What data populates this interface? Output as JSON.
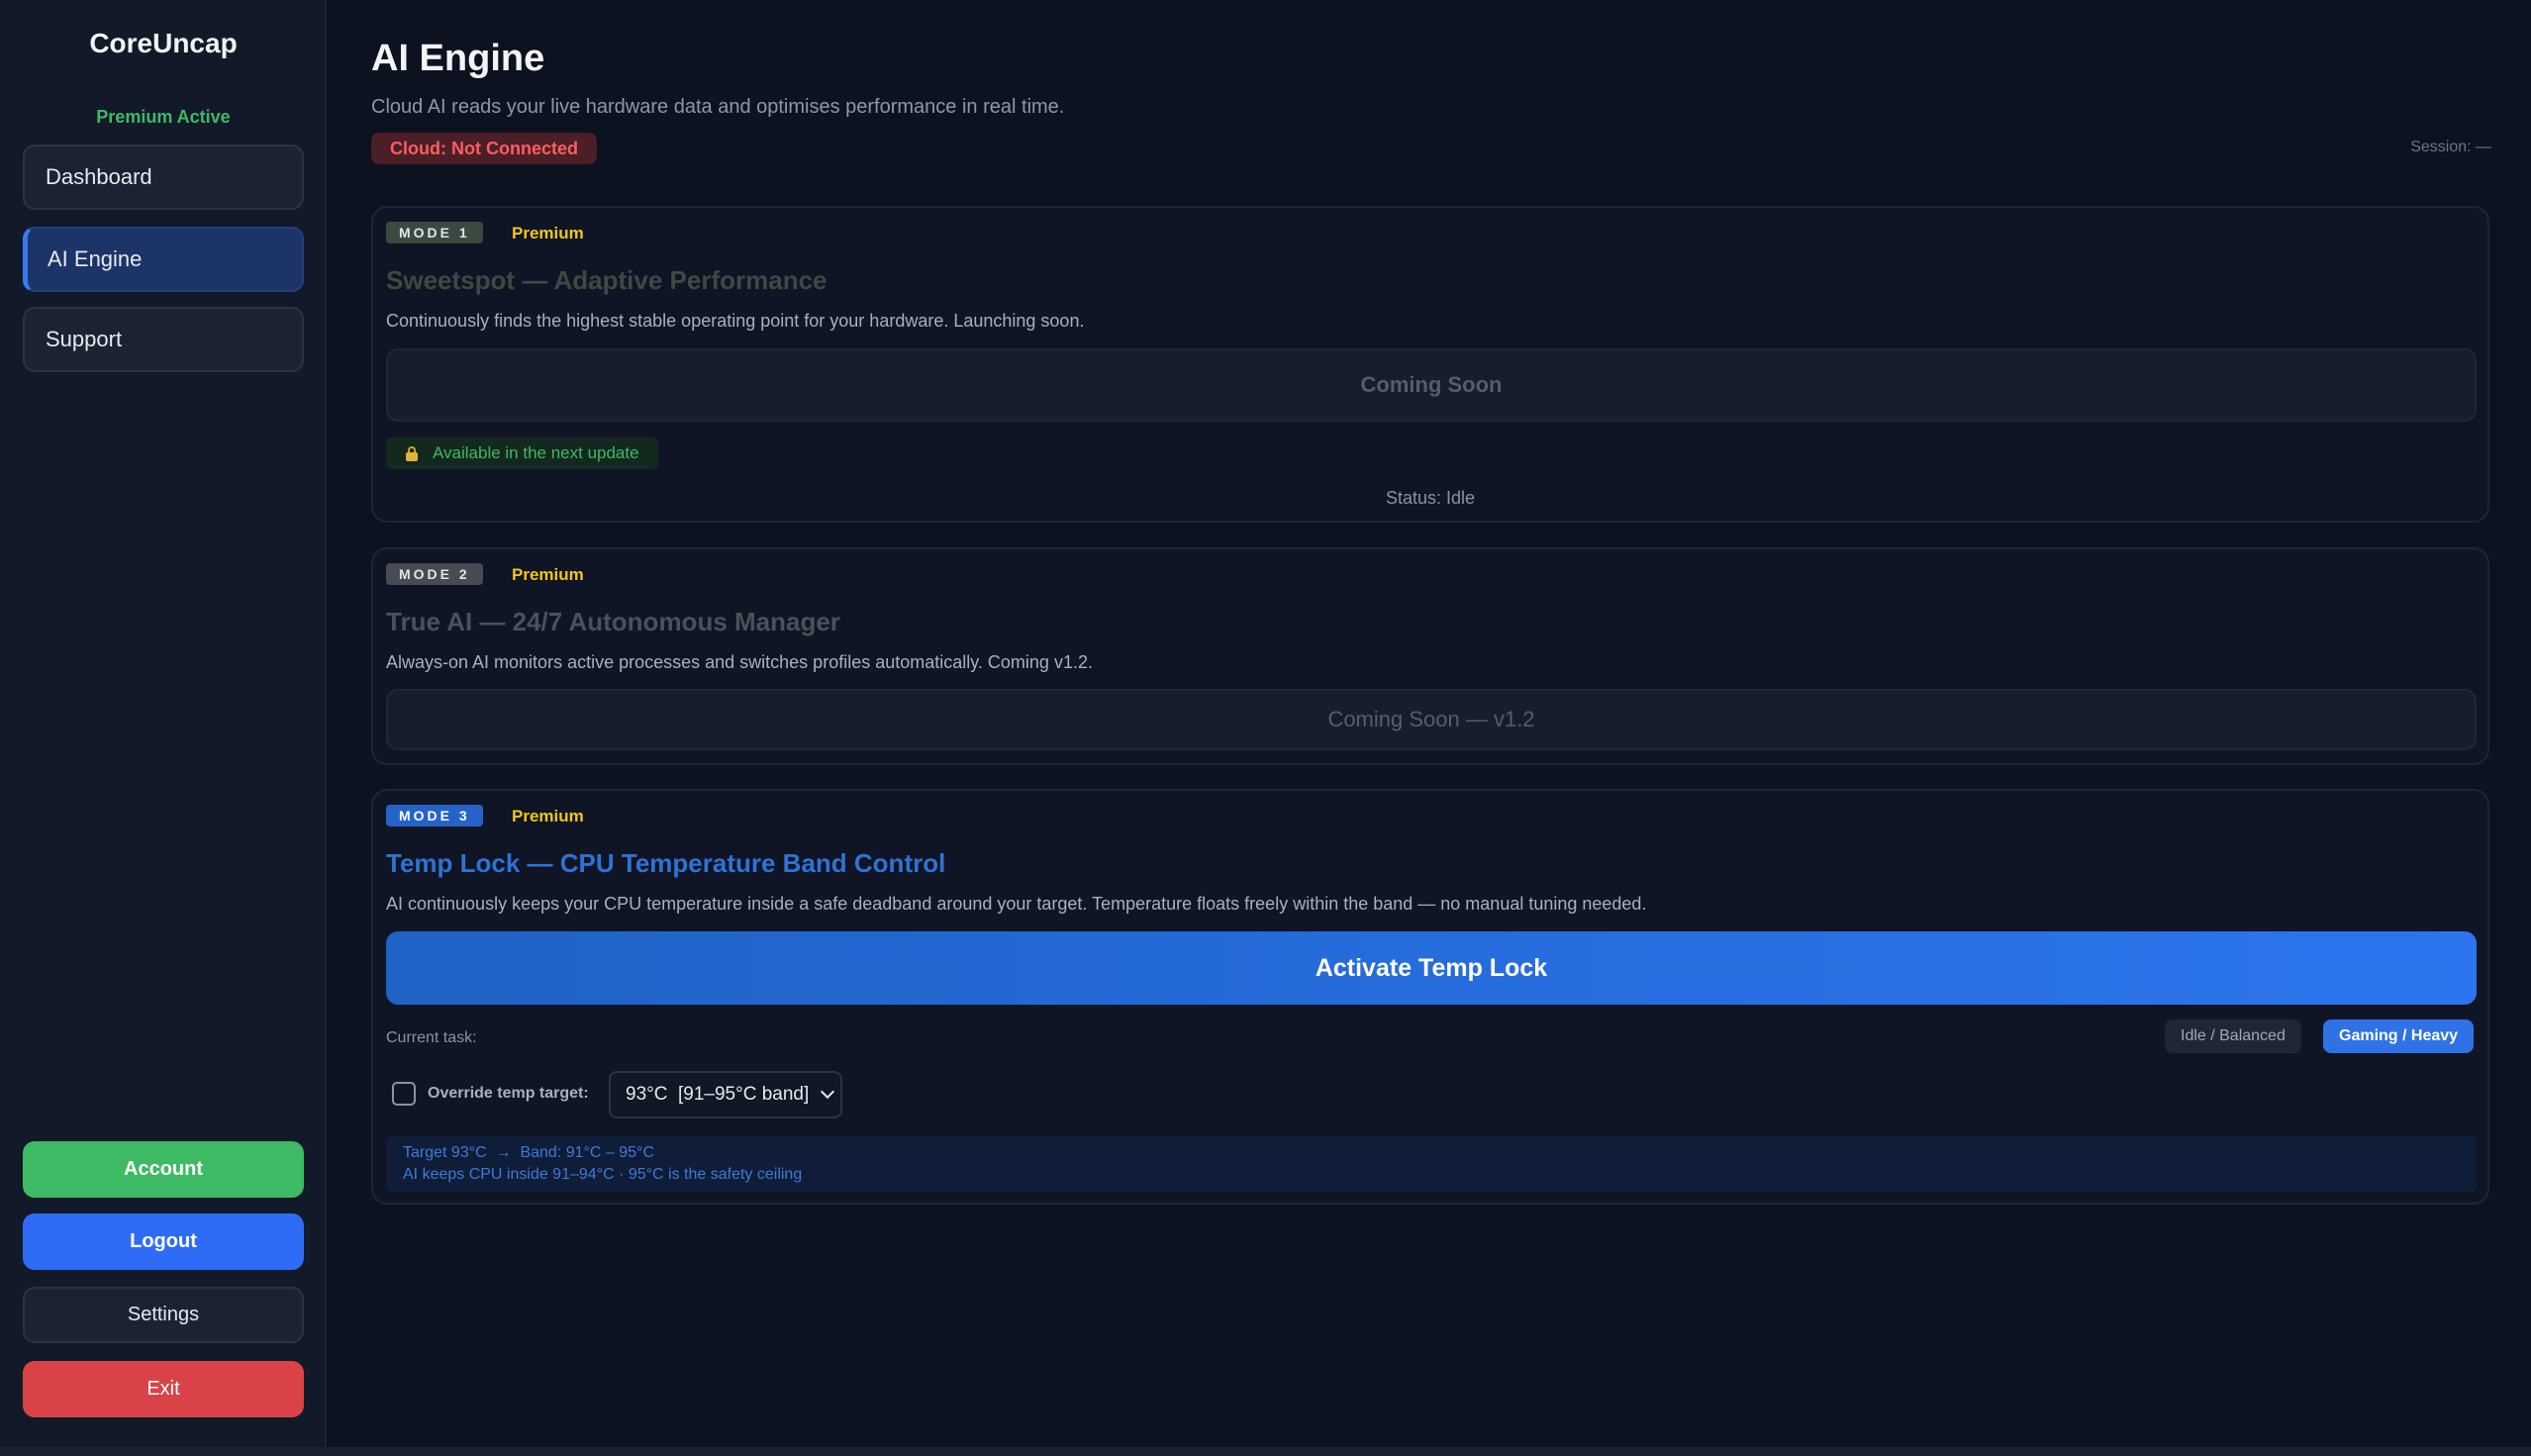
{
  "sidebar": {
    "brand": "CoreUncap",
    "premium_status": "Premium Active",
    "nav": [
      {
        "label": "Dashboard"
      },
      {
        "label": "AI Engine"
      },
      {
        "label": "Support"
      }
    ],
    "buttons": {
      "account": "Account",
      "logout": "Logout",
      "settings": "Settings",
      "exit": "Exit"
    }
  },
  "header": {
    "title": "AI Engine",
    "subtitle": "Cloud AI reads your live hardware data and optimises performance in real time.",
    "cloud_status": "Cloud: Not Connected",
    "session": "Session: —"
  },
  "modes": [
    {
      "tag": "MODE 1",
      "tier": "Premium",
      "title": "Sweetspot — Adaptive Performance",
      "description": "Continuously finds the highest stable operating point for your hardware. Launching soon.",
      "action": "Coming Soon",
      "availability": "Available in the next update",
      "status": "Status: Idle"
    },
    {
      "tag": "MODE 2",
      "tier": "Premium",
      "title": "True AI — 24/7 Autonomous Manager",
      "description": "Always-on AI monitors active processes and switches profiles automatically. Coming v1.2.",
      "action": "Coming Soon — v1.2"
    },
    {
      "tag": "MODE 3",
      "tier": "Premium",
      "title": "Temp Lock — CPU Temperature Band Control",
      "description": "AI continuously keeps your CPU temperature inside a safe deadband around your target. Temperature floats freely within the band — no manual tuning needed.",
      "action": "Activate Temp Lock",
      "current_task_label": "Current task:",
      "task_options": [
        "Idle / Balanced",
        "Gaming / Heavy"
      ],
      "selected_task": "Gaming / Heavy",
      "override_label": "Override temp target:",
      "override_checked": false,
      "temp_select_value": "93°C  [91–95°C band]",
      "band_line1": "Target 93°C  →  Band: 91°C – 95°C",
      "band_line2": "AI keeps CPU inside 91–94°C · 95°C is the safety ceiling"
    }
  ],
  "colors": {
    "accent": "#2f72e6",
    "success": "#3dba63",
    "danger": "#d94348",
    "premium": "#f5c518"
  }
}
